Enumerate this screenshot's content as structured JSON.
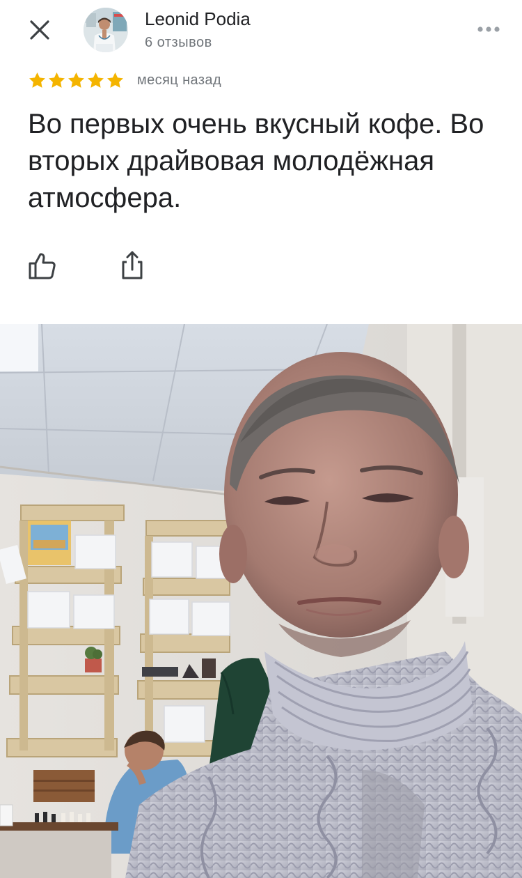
{
  "header": {
    "author_name": "Leonid Podia",
    "review_count": "6 отзывов"
  },
  "review": {
    "rating": 5,
    "max_rating": 5,
    "time_ago": "месяц назад",
    "text": "Во первых очень вкусный кофе. Во вторых драйвовая молодёжная атмосфера."
  },
  "colors": {
    "star": "#f4b400",
    "icon": "#3c4043",
    "secondary_text": "#70757a"
  },
  "icons": {
    "close": "close-icon",
    "more": "more-horizontal-icon",
    "like": "thumbs-up-icon",
    "share": "share-icon",
    "star": "star-icon"
  }
}
